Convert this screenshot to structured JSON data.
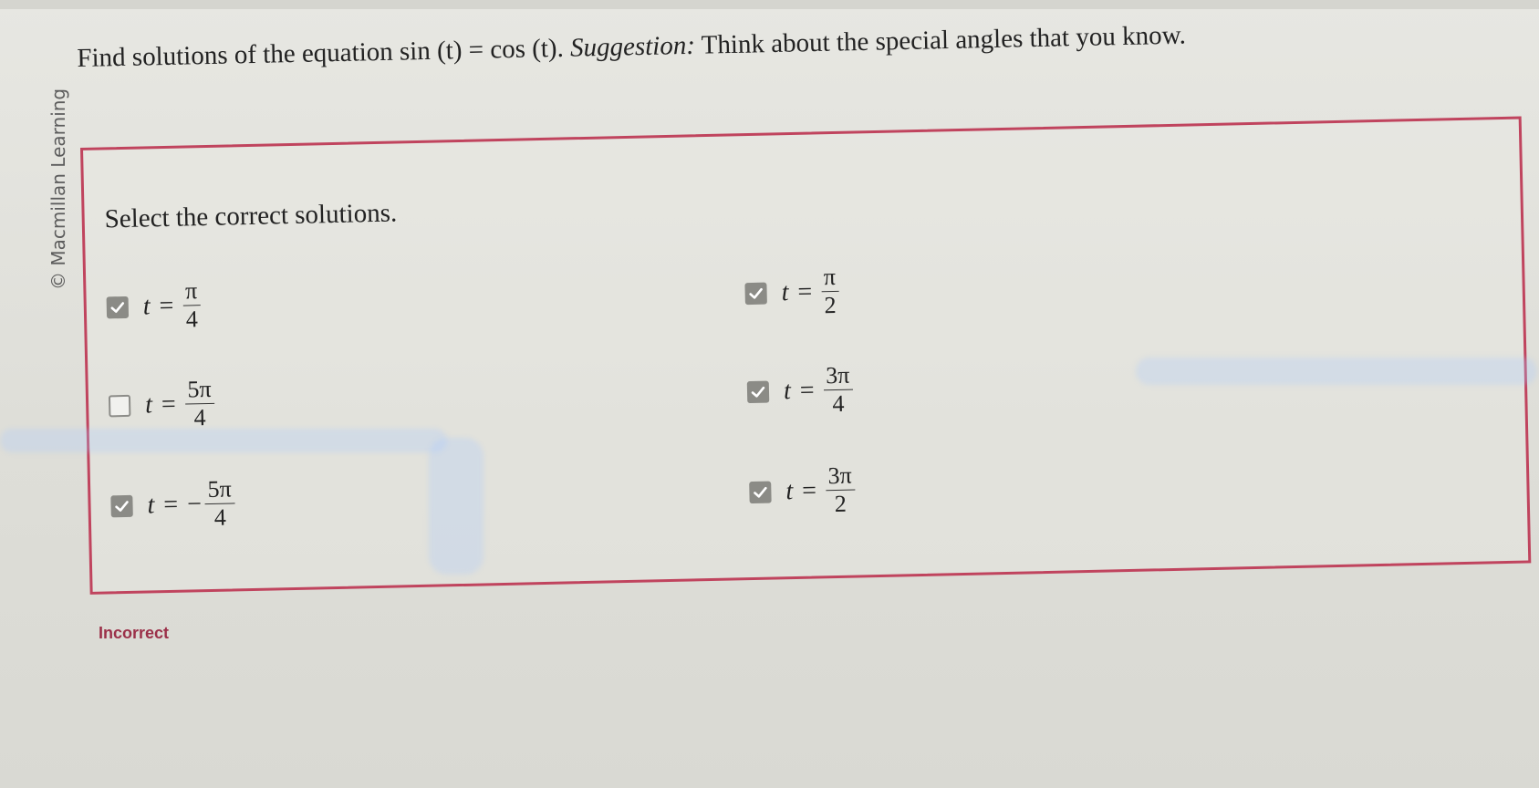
{
  "header": {
    "copyright": "© Macmillan Learning",
    "question": {
      "prefix": "Find solutions of the equation sin (t) = cos (t). ",
      "emphasis": "Suggestion:",
      "suffix": " Think about the special angles that you know."
    }
  },
  "panel": {
    "prompt": "Select the correct solutions.",
    "options": [
      {
        "var": "t",
        "eq": "=",
        "neg": "",
        "num": "π",
        "den": "4",
        "checked": true
      },
      {
        "var": "t",
        "eq": "=",
        "neg": "",
        "num": "π",
        "den": "2",
        "checked": true
      },
      {
        "var": "t",
        "eq": "=",
        "neg": "",
        "num": "5π",
        "den": "4",
        "checked": false
      },
      {
        "var": "t",
        "eq": "=",
        "neg": "",
        "num": "3π",
        "den": "4",
        "checked": true
      },
      {
        "var": "t",
        "eq": "=",
        "neg": "−",
        "num": "5π",
        "den": "4",
        "checked": true
      },
      {
        "var": "t",
        "eq": "=",
        "neg": "",
        "num": "3π",
        "den": "2",
        "checked": true
      }
    ]
  },
  "status": "Incorrect",
  "colors": {
    "accent": "#c0445e",
    "checkbox_checked": "#8b8b86",
    "status": "#9b3049"
  },
  "icons": [
    "checkmark-icon"
  ]
}
